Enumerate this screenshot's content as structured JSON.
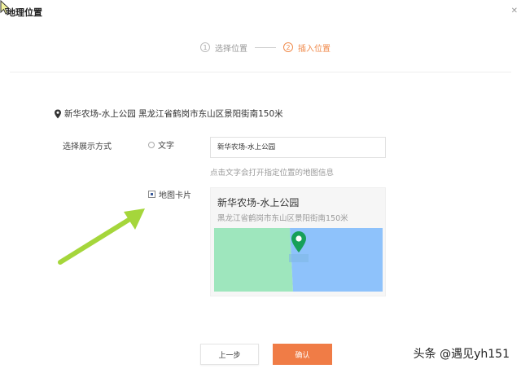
{
  "dialog": {
    "title": "地理位置",
    "close_icon": "close-icon"
  },
  "steps": [
    {
      "num": "1",
      "label": "选择位置",
      "active": false
    },
    {
      "num": "2",
      "label": "插入位置",
      "active": true
    }
  ],
  "location": {
    "text": "新华农场-水上公园 黑龙江省鹤岗市东山区景阳街南150米"
  },
  "display_mode": {
    "label": "选择展示方式",
    "text_option": {
      "label": "文字",
      "selected": false
    },
    "text_input_value": "新华农场-水上公园",
    "hint": "点击文字会打开指定位置的地图信息",
    "card_option": {
      "label": "地图卡片",
      "checked": true
    }
  },
  "card": {
    "title": "新华农场-水上公园",
    "address": "黑龙江省鹤岗市东山区景阳街南150米",
    "colors": {
      "green": "#9ee6bd",
      "blue": "#8ec2fb",
      "pin": "#17a05a"
    }
  },
  "buttons": {
    "prev": "上一步",
    "confirm": "确认"
  },
  "accent_color": "#f07c46",
  "arrow_color": "#a5d63b",
  "watermark": "头条 @遇见yh151"
}
